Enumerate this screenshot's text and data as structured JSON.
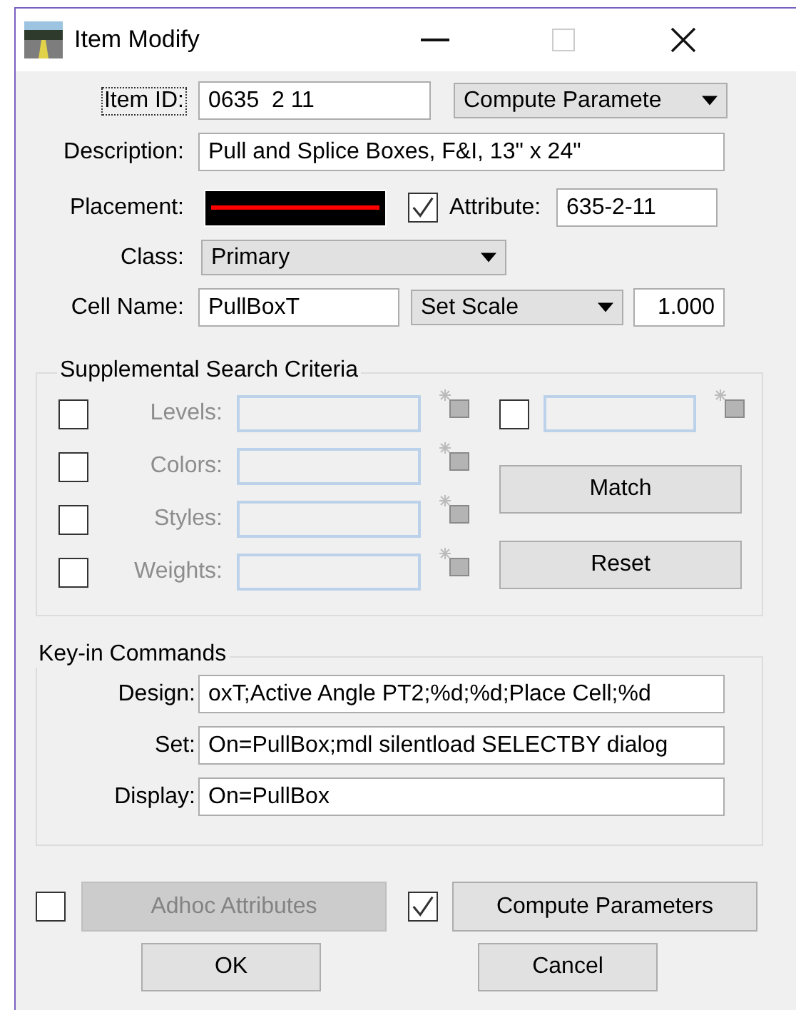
{
  "window": {
    "title": "Item Modify"
  },
  "item_id": {
    "label": "Item ID:",
    "value": "0635  2 11",
    "focused": true
  },
  "compute_dropdown": {
    "value": "Compute Paramete"
  },
  "description": {
    "label": "Description:",
    "value": "Pull and Splice Boxes, F&I, 13\" x 24\""
  },
  "placement": {
    "label": "Placement:"
  },
  "attribute": {
    "checked": true,
    "label": "Attribute:",
    "value": "635-2-11"
  },
  "class": {
    "label": "Class:",
    "value": "Primary"
  },
  "cell_name": {
    "label": "Cell Name:",
    "value": "PullBoxT",
    "scale_mode": "Set Scale",
    "scale": "1.000"
  },
  "supplemental": {
    "title": "Supplemental Search Criteria",
    "rows": [
      {
        "label": "Levels:",
        "checked": false,
        "disabled": true
      },
      {
        "label": "Colors:",
        "checked": false,
        "disabled": true
      },
      {
        "label": "Styles:",
        "checked": false,
        "disabled": true
      },
      {
        "label": "Weights:",
        "checked": false,
        "disabled": true
      }
    ],
    "extra": {
      "checked": false
    },
    "buttons": [
      "Match",
      "Reset"
    ]
  },
  "keyin": {
    "title": "Key-in Commands",
    "rows": [
      {
        "label": "Design:",
        "value": "oxT;Active Angle PT2;%d;%d;Place Cell;%d"
      },
      {
        "label": "Set:",
        "value": "On=PullBox;mdl silentload SELECTBY dialog"
      },
      {
        "label": "Display:",
        "value": "On=PullBox"
      }
    ]
  },
  "adhoc": {
    "checked": false,
    "label": "Adhoc Attributes",
    "disabled": true
  },
  "compute": {
    "checked": true,
    "label": "Compute Parameters",
    "disabled": false
  },
  "buttons": [
    "OK",
    "Cancel"
  ]
}
